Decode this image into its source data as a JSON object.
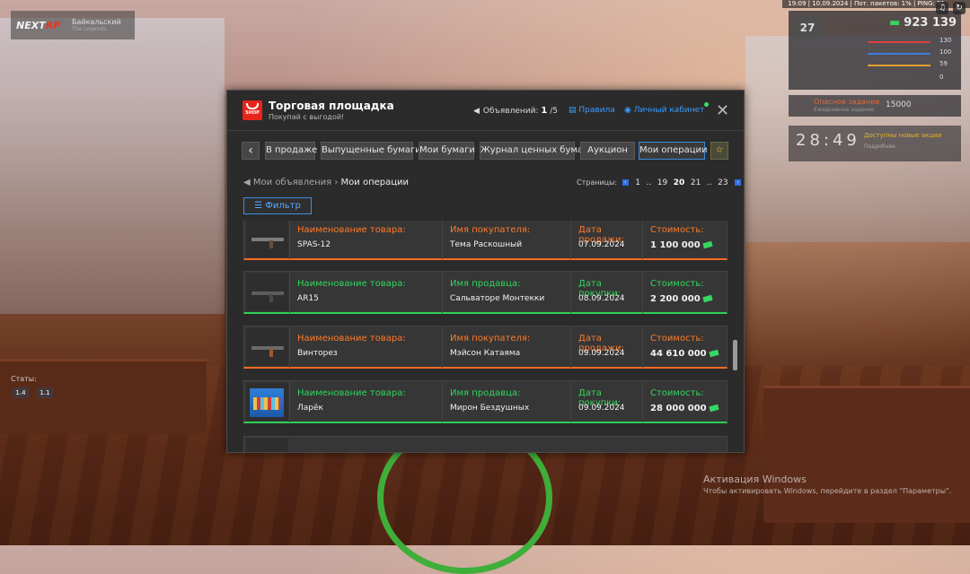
{
  "hud": {
    "topbar": "19:09 | 10.09.2024 | Пот. пакетов: 1% | PING: 51",
    "brand_a": "NEXT",
    "brand_b": "RP",
    "server": "Байкальский",
    "server_sub": "The Legends",
    "level": "27",
    "money": "923 139",
    "stats": [
      "130",
      "100",
      "59",
      "0"
    ],
    "mission_title": "Опасное задание",
    "mission_sub": "Ежедневное задание",
    "mission_value": "15000",
    "clock_h": "28",
    "clock_m": "49",
    "new_actions": "Доступны новые акции",
    "new_actions_sub": "Подробнее",
    "stats_label": "Статы:",
    "stat_btns": [
      "1.4",
      "1.1"
    ],
    "win_title": "Активация Windows",
    "win_sub": "Чтобы активировать Windows, перейдите в раздел \"Параметры\"."
  },
  "panel": {
    "icon_text": "SHOP",
    "title": "Торговая площадка",
    "subtitle": "Покупай с выгодой!",
    "ads_label": "Объявлений:",
    "ads_count": "1",
    "ads_max": "/5",
    "rules": "Правила",
    "cabinet": "Личный кабинет",
    "close": "✕",
    "tabs": [
      "В продаже",
      "Выпущенные бумаги",
      "Мои бумаги",
      "Журнал ценных бумаг",
      "Аукцион",
      "Мои операции"
    ],
    "back": "‹",
    "star": "☆",
    "crumb_parent": "Мои объявления",
    "crumb_sep": "›",
    "crumb_current": "Мои операции",
    "pages_label": "Страницы:",
    "pages": [
      "1",
      "..",
      "19",
      "20",
      "21",
      "..",
      "23"
    ],
    "current_page": "20",
    "filter": "Фильтр"
  },
  "rows": [
    {
      "type": "sell",
      "item_label": "Наименование товара:",
      "item": "SPAS-12",
      "person_label": "Имя покупателя:",
      "person": "Тема Раскошный",
      "date_label": "Дата продажи:",
      "date": "07.09.2024",
      "price_label": "Стоимость:",
      "price": "1 100 000"
    },
    {
      "type": "buy",
      "item_label": "Наименование товара:",
      "item": "AR15",
      "person_label": "Имя продавца:",
      "person": "Сальваторе Монтекки",
      "date_label": "Дата покупки:",
      "date": "08.09.2024",
      "price_label": "Стоимость:",
      "price": "2 200 000"
    },
    {
      "type": "sell",
      "item_label": "Наименование товара:",
      "item": "Винторез",
      "person_label": "Имя покупателя:",
      "person": "Мэйсон Катаяма",
      "date_label": "Дата продажи:",
      "date": "09.09.2024",
      "price_label": "Стоимость:",
      "price": "44 610 000"
    },
    {
      "type": "buy",
      "item_label": "Наименование товара:",
      "item": "Ларёк",
      "person_label": "Имя продавца:",
      "person": "Мирон Бездушных",
      "date_label": "Дата покупки:",
      "date": "09.09.2024",
      "price_label": "Стоимость:",
      "price": "28 000 000"
    }
  ],
  "colors": {
    "sell": "#ff6a1f",
    "buy": "#2fce57",
    "accent": "#3b8de0",
    "shop": "#e8251c"
  }
}
